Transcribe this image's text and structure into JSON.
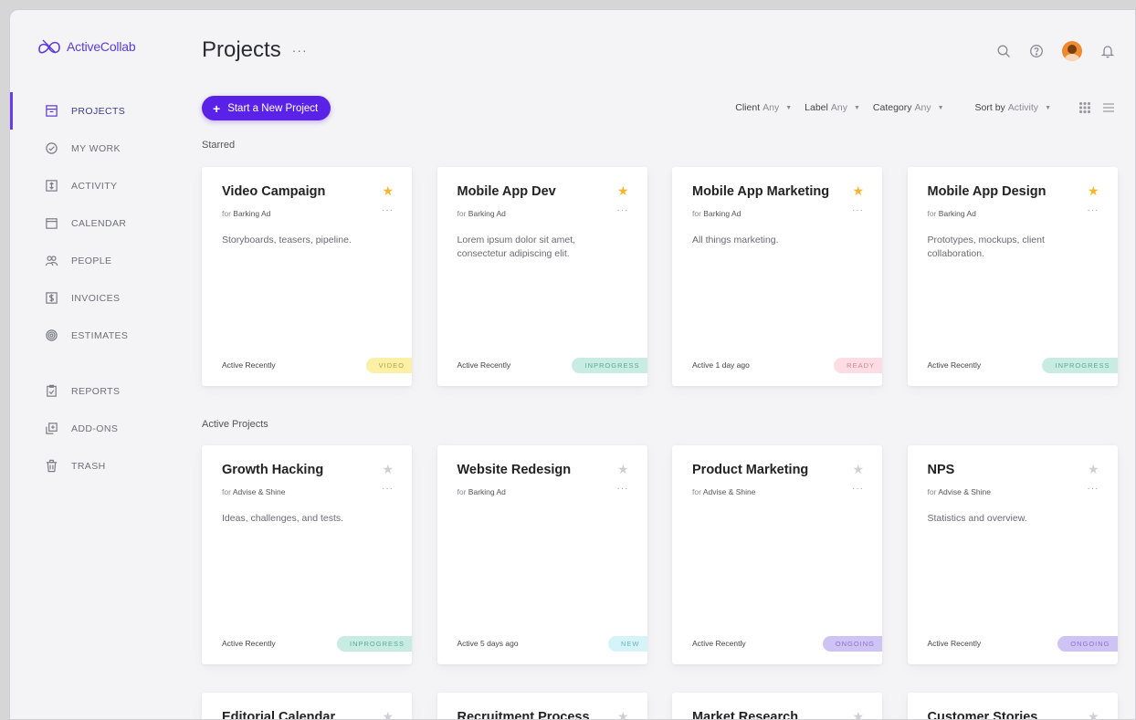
{
  "app": {
    "logo_text": "ActiveCollab"
  },
  "sidebar": {
    "items": [
      {
        "label": "PROJECTS",
        "icon": "projects-icon",
        "active": true
      },
      {
        "label": "MY WORK",
        "icon": "check-circle-icon"
      },
      {
        "label": "ACTIVITY",
        "icon": "activity-icon"
      },
      {
        "label": "CALENDAR",
        "icon": "calendar-icon"
      },
      {
        "label": "PEOPLE",
        "icon": "people-icon"
      },
      {
        "label": "INVOICES",
        "icon": "invoice-icon"
      },
      {
        "label": "ESTIMATES",
        "icon": "estimates-icon"
      },
      {
        "label": "REPORTS",
        "icon": "reports-icon"
      },
      {
        "label": "ADD-ONS",
        "icon": "addons-icon"
      },
      {
        "label": "TRASH",
        "icon": "trash-icon"
      }
    ]
  },
  "header": {
    "title": "Projects",
    "more": "···",
    "icons": [
      "search-icon",
      "help-icon",
      "avatar",
      "bell-icon"
    ]
  },
  "toolbar": {
    "new_project": "Start a New Project",
    "filters": [
      {
        "label": "Client",
        "value": "Any"
      },
      {
        "label": "Label",
        "value": "Any"
      },
      {
        "label": "Category",
        "value": "Any"
      }
    ],
    "sort": {
      "label": "Sort by",
      "value": "Activity"
    }
  },
  "sections": {
    "starred": "Starred",
    "active": "Active Projects"
  },
  "badge_colors": {
    "VIDEO": {
      "bg": "#fbf0a6",
      "fg": "#b5a13a"
    },
    "INPROGRESS": {
      "bg": "#c9ece2",
      "fg": "#5aa994"
    },
    "READY": {
      "bg": "#fbdde3",
      "fg": "#d98494"
    },
    "NEW": {
      "bg": "#d6f3f7",
      "fg": "#67b6c4"
    },
    "ONGOING": {
      "bg": "#cfc3f4",
      "fg": "#8a72d8"
    }
  },
  "starred_projects": [
    {
      "name": "Video Campaign",
      "client": "Barking Ad",
      "description": "Storyboards, teasers, pipeline.",
      "activity": "Active Recently",
      "badge": "VIDEO",
      "starred": true
    },
    {
      "name": "Mobile App Dev",
      "client": "Barking Ad",
      "description": "Lorem ipsum dolor sit amet, consectetur adipiscing elit.",
      "activity": "Active Recently",
      "badge": "INPROGRESS",
      "starred": true
    },
    {
      "name": "Mobile App Marketing",
      "client": "Barking Ad",
      "description": "All things marketing.",
      "activity": "Active 1 day ago",
      "badge": "READY",
      "starred": true
    },
    {
      "name": "Mobile App Design",
      "client": "Barking Ad",
      "description": "Prototypes, mockups, client collaboration.",
      "activity": "Active Recently",
      "badge": "INPROGRESS",
      "starred": true
    }
  ],
  "active_projects": [
    {
      "name": "Growth Hacking",
      "client": "Advise & Shine",
      "description": "Ideas, challenges, and tests.",
      "activity": "Active Recently",
      "badge": "INPROGRESS",
      "starred": false
    },
    {
      "name": "Website Redesign",
      "client": "Barking Ad",
      "description": "",
      "activity": "Active 5 days ago",
      "badge": "NEW",
      "starred": false
    },
    {
      "name": "Product Marketing",
      "client": "Advise & Shine",
      "description": "",
      "activity": "Active Recently",
      "badge": "ONGOING",
      "starred": false
    },
    {
      "name": "NPS",
      "client": "Advise & Shine",
      "description": "Statistics and overview.",
      "activity": "Active Recently",
      "badge": "ONGOING",
      "starred": false
    },
    {
      "name": "Editorial Calendar",
      "client": "",
      "description": "",
      "activity": "",
      "badge": "",
      "starred": false
    },
    {
      "name": "Recruitment Process",
      "client": "",
      "description": "",
      "activity": "",
      "badge": "",
      "starred": false
    },
    {
      "name": "Market Research",
      "client": "",
      "description": "",
      "activity": "",
      "badge": "",
      "starred": false
    },
    {
      "name": "Customer Stories",
      "client": "",
      "description": "",
      "activity": "",
      "badge": "",
      "starred": false
    }
  ],
  "card_labels": {
    "for": "for",
    "more": "···"
  }
}
